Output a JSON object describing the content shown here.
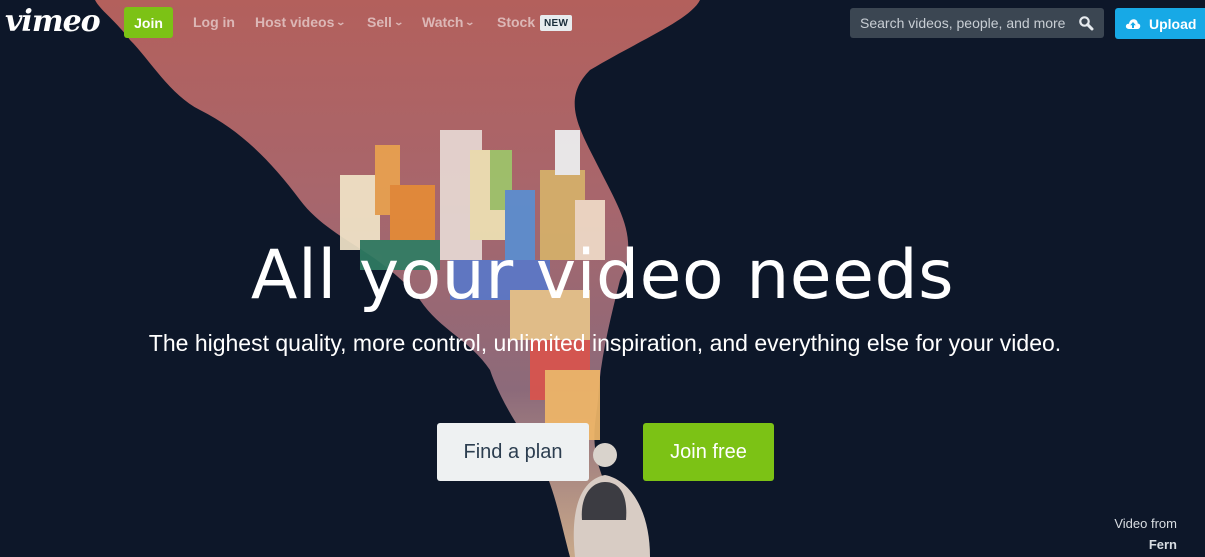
{
  "header": {
    "logo": "vimeo",
    "join_label": "Join",
    "nav": [
      {
        "label": "Log in",
        "has_dropdown": false
      },
      {
        "label": "Host videos",
        "has_dropdown": true
      },
      {
        "label": "Sell",
        "has_dropdown": true
      },
      {
        "label": "Watch",
        "has_dropdown": true
      },
      {
        "label": "Stock",
        "has_dropdown": false
      }
    ],
    "stock_badge": "NEW",
    "search": {
      "placeholder": "Search videos, people, and more",
      "icon": "search-icon"
    },
    "upload": {
      "label": "Upload",
      "icon": "cloud-upload-icon"
    },
    "chevron": "⌄"
  },
  "hero": {
    "title": "All your video needs",
    "subtitle": "The highest quality, more control, unlimited inspiration, and everything else for your video.",
    "find_plan_label": "Find a plan",
    "join_free_label": "Join free"
  },
  "credit": {
    "prefix": "Video from",
    "author": "Fern"
  },
  "colors": {
    "background": "#0d1729",
    "green": "#7cc215",
    "blue": "#17a9e6",
    "search_bg": "#3b4652",
    "light_button": "#eef1f2"
  }
}
